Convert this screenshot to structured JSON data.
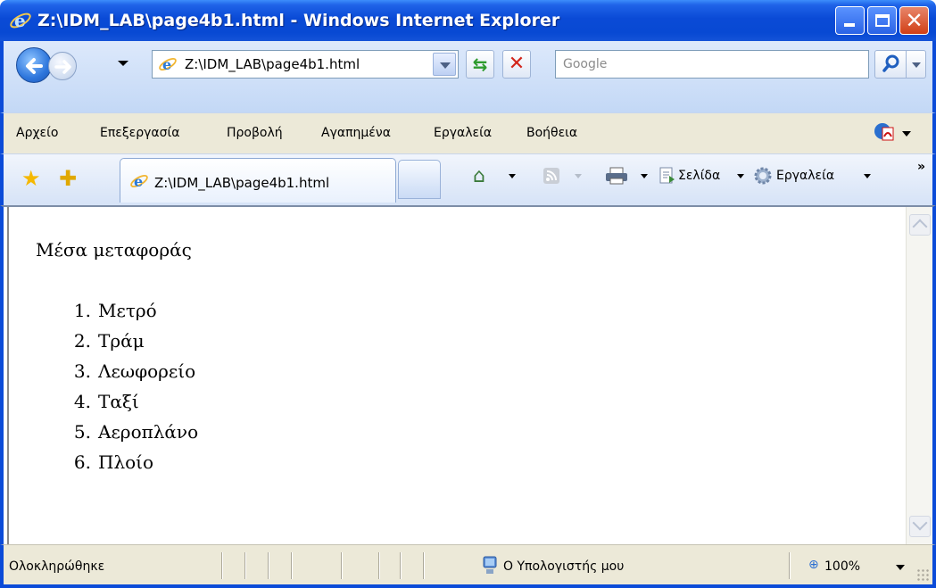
{
  "window": {
    "title": "Z:\\IDM_LAB\\page4b1.html - Windows Internet Explorer"
  },
  "address_bar": {
    "url": "Z:\\IDM_LAB\\page4b1.html",
    "search_placeholder": "Google"
  },
  "menu": {
    "items": [
      "Αρχείο",
      "Επεξεργασία",
      "Προβολή",
      "Αγαπημένα",
      "Εργαλεία",
      "Βοήθεια"
    ]
  },
  "tabs": {
    "active_label": "Z:\\IDM_LAB\\page4b1.html"
  },
  "command_bar": {
    "page_label": "Σελίδα",
    "tools_label": "Εργαλεία",
    "chevron": "»"
  },
  "content": {
    "heading": "Μέσα μεταφοράς",
    "list": [
      {
        "num": "1.",
        "text": "Μετρό"
      },
      {
        "num": "2.",
        "text": "Τράμ"
      },
      {
        "num": "3.",
        "text": "Λεωφορείο"
      },
      {
        "num": "4.",
        "text": "Ταξί"
      },
      {
        "num": "5.",
        "text": "Αεροπλάνο"
      },
      {
        "num": "6.",
        "text": "Πλοίο"
      }
    ]
  },
  "status_bar": {
    "status": "Ολοκληρώθηκε",
    "zone": "Ο Υπολογιστής μου",
    "zoom": "100%"
  },
  "colors": {
    "titlebar": "#0849d3",
    "frame": "#0b4bd8",
    "chrome": "#ece9d8"
  }
}
